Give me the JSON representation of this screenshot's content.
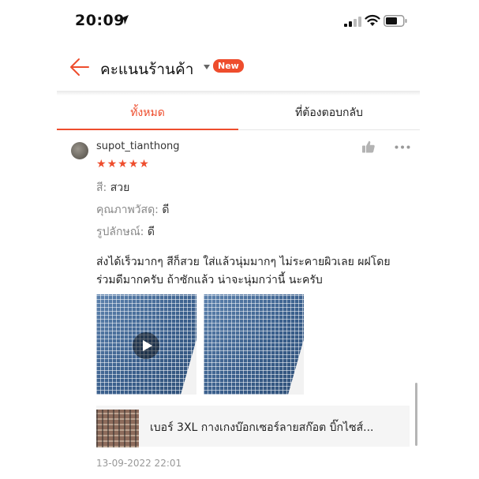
{
  "status_bar": {
    "time": "20:09"
  },
  "header": {
    "title": "คะแนนร้านค้า",
    "badge": "New"
  },
  "tabs": [
    {
      "label": "ทั้งหมด",
      "active": true
    },
    {
      "label": "ที่ต้องตอบกลับ",
      "active": false
    }
  ],
  "review": {
    "username": "supot_tianthong",
    "rating": 5,
    "stars": [
      "★",
      "★",
      "★",
      "★",
      "★"
    ],
    "attributes": [
      {
        "key": "สี:",
        "value": "สวย"
      },
      {
        "key": "คุณภาพวัสดุ:",
        "value": "ดี"
      },
      {
        "key": "รูปลักษณ์:",
        "value": "ดี"
      }
    ],
    "comment_line_1": "ส่งได้เร็วมากๆ สีก็สวย ใส่แล้วนุ่มมากๆ ไม่ระคายผิวเลย ผฝโดย",
    "comment_line_2": "ร่วมดีมากครับ ถ้าซักแล้ว น่าจะนุ่มกว่านี้ นะครับ",
    "media": [
      {
        "type": "video"
      },
      {
        "type": "image"
      }
    ],
    "product_title": "เบอร์ 3XL กางเกงบ๊อกเซอร์ลายสก๊อต บิ๊กไซส์...",
    "date": "13-09-2022 22:01"
  },
  "colors": {
    "accent": "#ee4d2d",
    "muted_text": "#888888"
  }
}
